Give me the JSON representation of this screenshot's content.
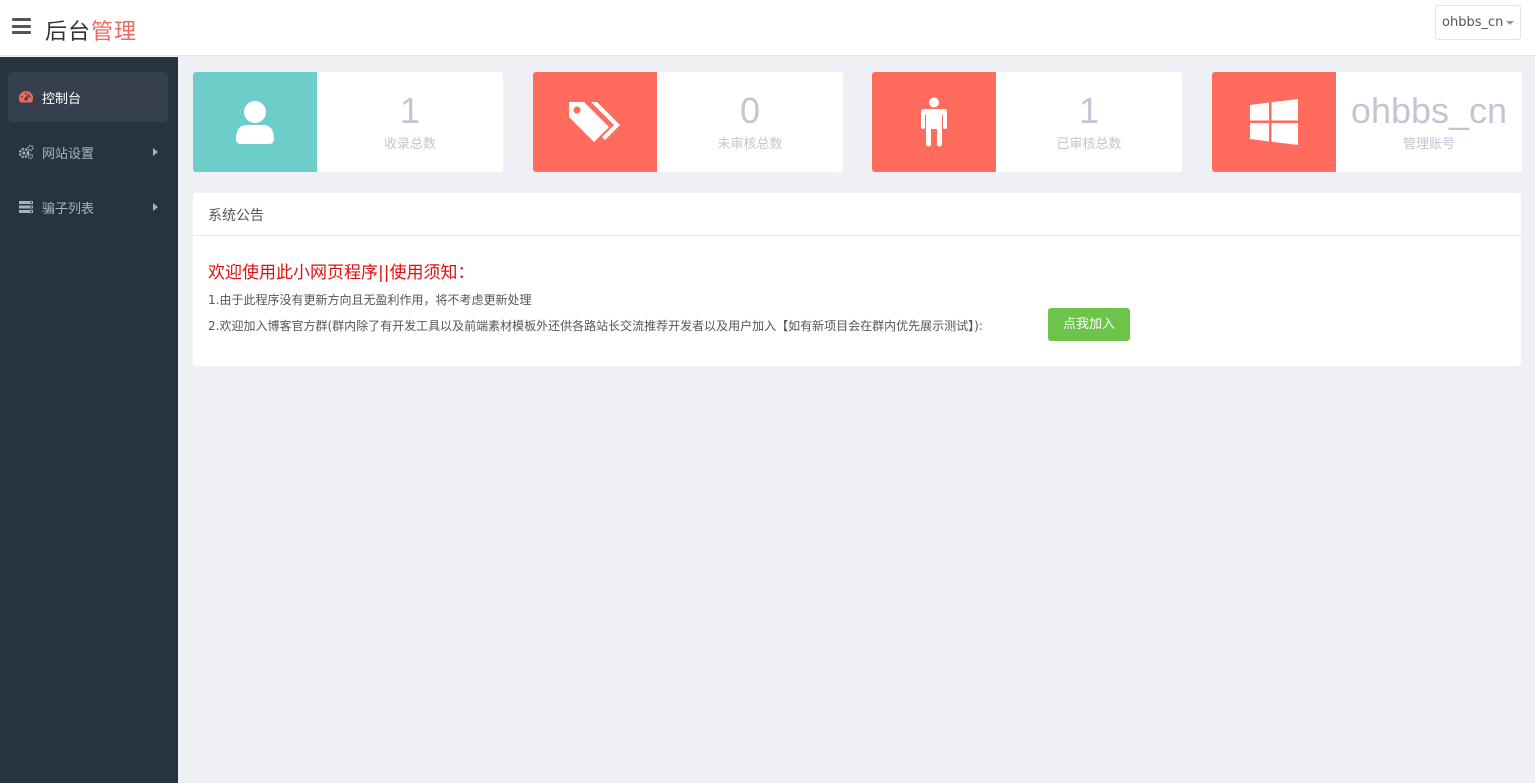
{
  "header": {
    "brand_part1": "后台",
    "brand_part2": "管理",
    "user_dropdown": "ohbbs_cn",
    "accent_color": "#f0685b"
  },
  "sidebar": {
    "items": [
      {
        "label": "控制台",
        "icon": "dashboard-icon",
        "active": true
      },
      {
        "label": "网站设置",
        "icon": "gears-icon",
        "expandable": true
      },
      {
        "label": "骗子列表",
        "icon": "list-icon",
        "expandable": true
      }
    ]
  },
  "stats": [
    {
      "value": "1",
      "caption": "收录总数",
      "icon": "user-icon",
      "color": "#6dcdc9"
    },
    {
      "value": "0",
      "caption": "未审核总数",
      "icon": "tags-icon",
      "color": "#ff6b5d"
    },
    {
      "value": "1",
      "caption": "已审核总数",
      "icon": "person-icon",
      "color": "#ff6b5d"
    },
    {
      "value": "ohbbs_cn",
      "caption": "管理账号",
      "icon": "windows-icon",
      "color": "#ff6b5d"
    }
  ],
  "announcement": {
    "heading": "系统公告",
    "title": "欢迎使用此小网页程序||使用须知：",
    "line1": "1.由于此程序没有更新方向且无盈利作用，将不考虑更新处理",
    "line2": "2.欢迎加入博客官方群(群内除了有开发工具以及前端素材模板外还供各路站长交流推荐开发者以及用户加入【如有新项目会在群内优先展示测试】):",
    "join_button": "点我加入",
    "button_color": "#6cc54a"
  }
}
